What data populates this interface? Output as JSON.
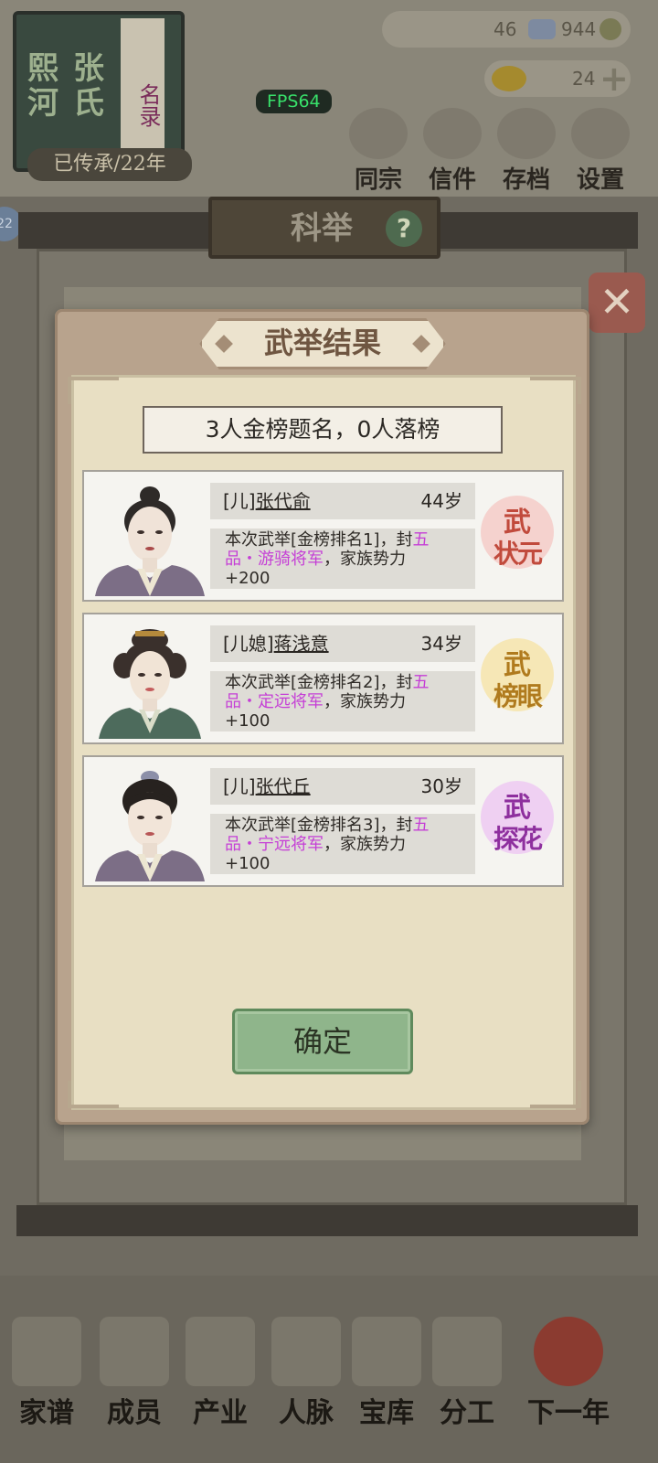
{
  "hud": {
    "family_name_1": "熙河",
    "family_name_2": "张氏",
    "roster_label": "名录",
    "generation": "已传承/22年",
    "fps": "FPS64",
    "resource_1_left": "46",
    "resource_1_right": "944",
    "resource_2": "24",
    "side_badge": "22",
    "menu": [
      "同宗",
      "信件",
      "存档",
      "设置"
    ]
  },
  "panel": {
    "title": "科举"
  },
  "bottom_nav": [
    "家谱",
    "成员",
    "产业",
    "人脉",
    "宝库",
    "分工",
    "下一年"
  ],
  "dialog": {
    "title": "武举结果",
    "summary": "3人金榜题名，0人落榜",
    "results": [
      {
        "relation": "[儿]",
        "name": "张代俞",
        "age": "44岁",
        "desc_1": "本次武举[金榜排名1]，封",
        "title_1": "五",
        "title_2": "品・游骑将军",
        "desc_2": "，家族势力",
        "desc_3": "+200",
        "seal_1": "武",
        "seal_2": "状元",
        "seal_color": "#c14a3c",
        "seal_bg": "#f4c7c3"
      },
      {
        "relation": "[儿媳]",
        "name": "蒋浅意",
        "age": "34岁",
        "desc_1": "本次武举[金榜排名2]，封",
        "title_1": "五",
        "title_2": "品・定远将军",
        "desc_2": "，家族势力",
        "desc_3": "+100",
        "seal_1": "武",
        "seal_2": "榜眼",
        "seal_color": "#b07b1e",
        "seal_bg": "#f6e3a8"
      },
      {
        "relation": "[儿]",
        "name": "张代丘",
        "age": "30岁",
        "desc_1": "本次武举[金榜排名3]，封",
        "title_1": "五",
        "title_2": "品・宁远将军",
        "desc_2": "，家族势力",
        "desc_3": "+100",
        "seal_1": "武",
        "seal_2": "探花",
        "seal_color": "#8e2f9e",
        "seal_bg": "#eec7f2"
      }
    ],
    "confirm_label": "确定"
  }
}
